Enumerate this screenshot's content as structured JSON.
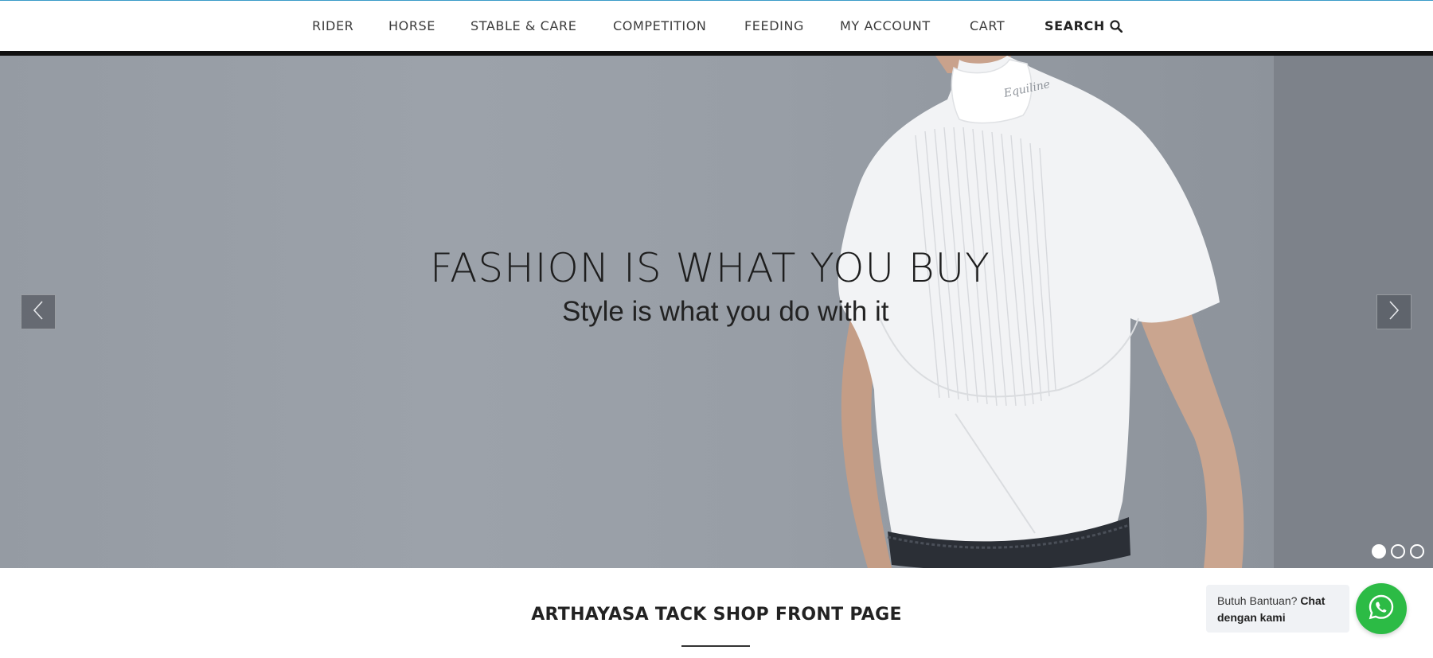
{
  "nav": {
    "items": [
      {
        "label": "RIDER"
      },
      {
        "label": "HORSE"
      },
      {
        "label": "STABLE & CARE"
      },
      {
        "label": "COMPETITION"
      },
      {
        "label": "FEEDING"
      },
      {
        "label": "MY ACCOUNT"
      },
      {
        "label": "CART"
      }
    ],
    "search_label": "SEARCH",
    "search_icon": "search-icon"
  },
  "hero": {
    "title": "FASHION IS WHAT YOU BUY",
    "subtitle": "Style is what you do with it",
    "prev_icon": "chevron-left-icon",
    "next_icon": "chevron-right-icon",
    "slides_total": 3,
    "active_slide": 1,
    "shirt_logo_text": "Equiline"
  },
  "front_page": {
    "title": "ARTHAYASA TACK SHOP FRONT PAGE"
  },
  "chat": {
    "prompt": "Butuh Bantuan?",
    "cta": "Chat dengan kami",
    "icon": "whatsapp-icon"
  },
  "colors": {
    "accent_top_border": "#3a9bc8",
    "whatsapp_green": "#2cbb45",
    "hero_bg": "#9aa0a8"
  }
}
